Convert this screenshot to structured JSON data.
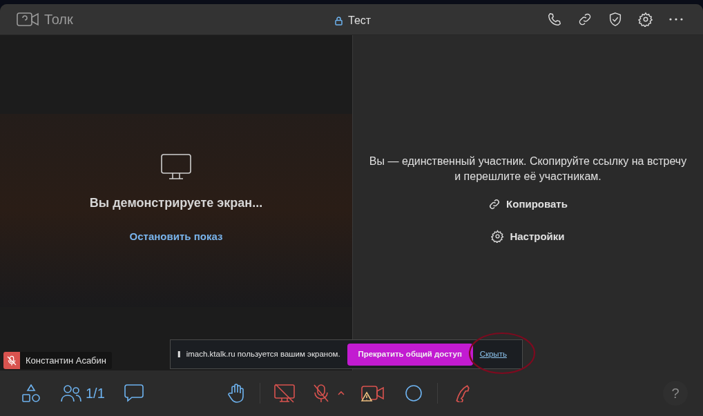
{
  "header": {
    "app_name": "Толк",
    "title": "Тест"
  },
  "screen_share": {
    "message": "Вы демонстрируете экран...",
    "stop_link": "Остановить показ"
  },
  "invite": {
    "message": "Вы — единственный участник. Скопируйте ссылку на встречу и перешлите её участникам.",
    "copy": "Копировать",
    "settings": "Настройки"
  },
  "participant": {
    "name": "Константин Асабин",
    "muted": true
  },
  "share_notice": {
    "pause": "II",
    "text": "imach.ktalk.ru пользуется вашим экраном.",
    "stop_button": "Прекратить общий доступ",
    "hide_link": "Скрыть"
  },
  "toolbar": {
    "participants_count": "1/1",
    "mic_muted": true,
    "camera_warning": true,
    "help": "?"
  }
}
